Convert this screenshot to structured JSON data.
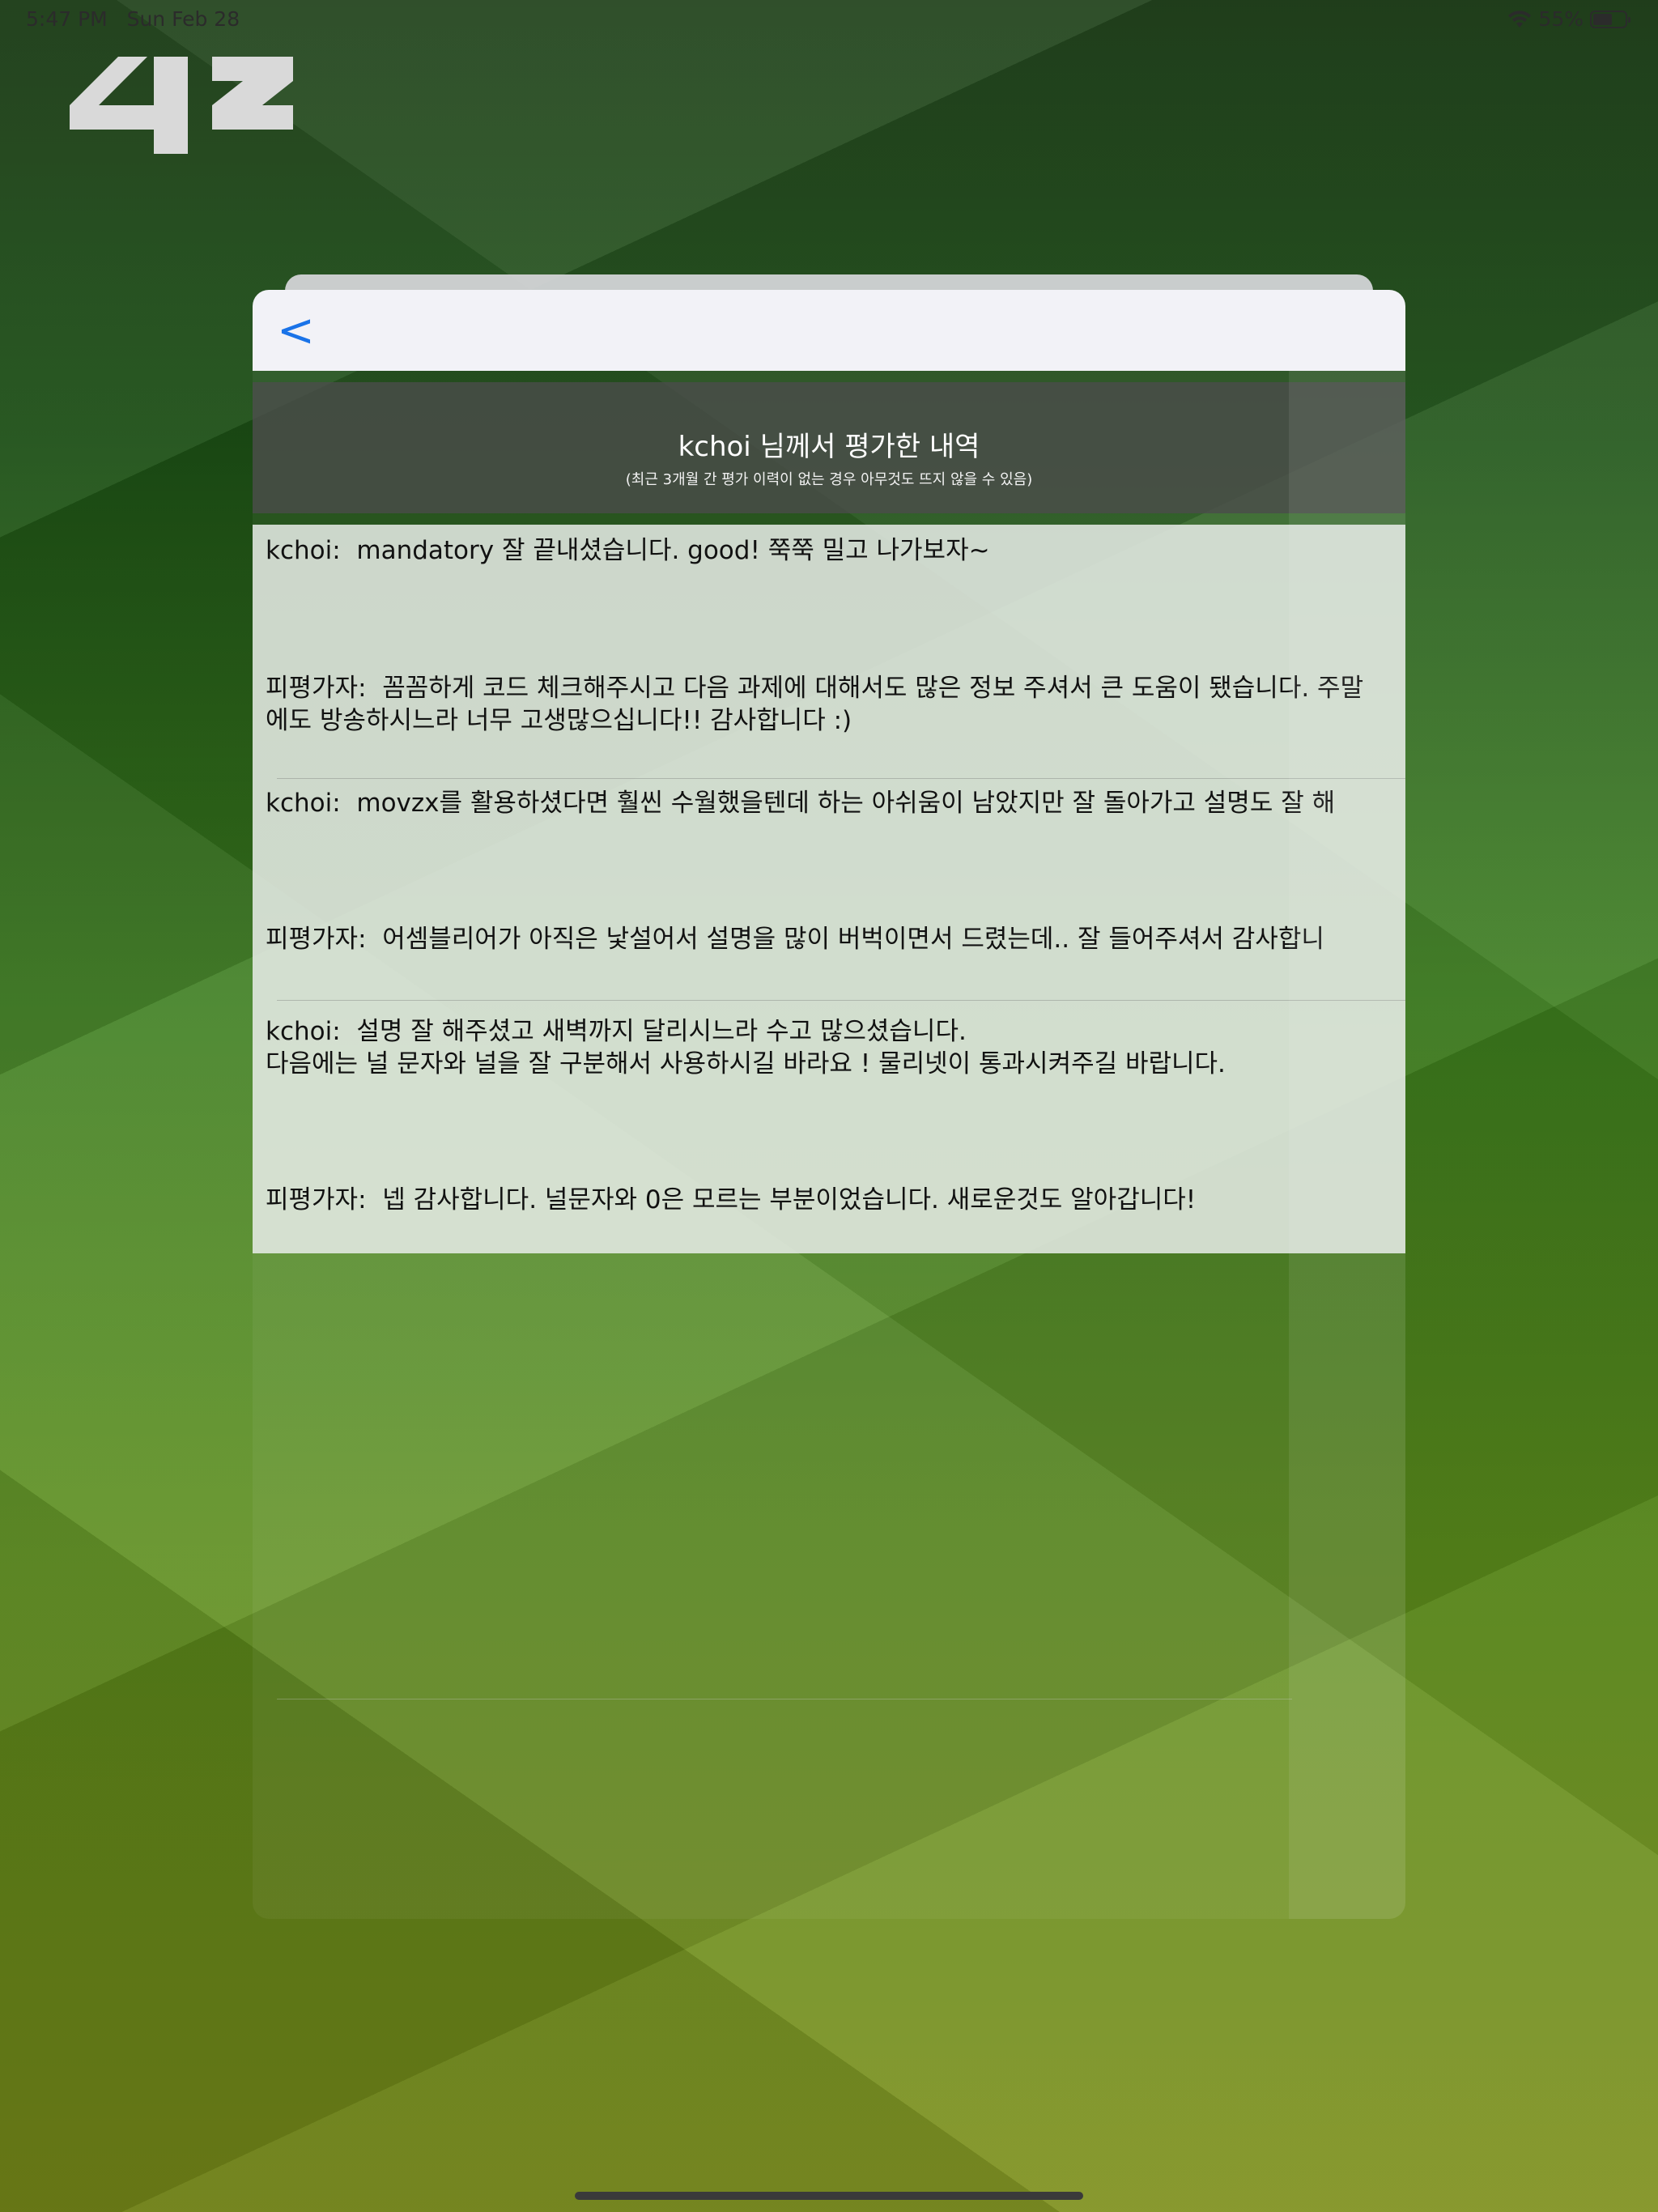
{
  "status_bar": {
    "time": "5:47 PM",
    "date": "Sun Feb 28",
    "battery": "55%"
  },
  "logo": {
    "text": "42"
  },
  "nav": {
    "back_label": "<"
  },
  "header": {
    "title": "kchoi 님께서 평가한 내역",
    "subtitle": "(최근 3개월 간 평가 이력이 없는 경우 아무것도 뜨지 않을 수 있음)"
  },
  "evaluations": [
    {
      "evaluator": "kchoi:  mandatory 잘 끝내셨습니다. good! 쭉쭉 밀고 나가보자~",
      "evaluatee": "피평가자:  꼼꼼하게 코드 체크해주시고 다음 과제에 대해서도 많은 정보 주셔서 큰 도움이 됐습니다. 주말에도 방송하시느라 너무 고생많으십니다!! 감사합니다 :)"
    },
    {
      "evaluator": "kchoi:  movzx를 활용하셨다면 훨씬 수월했을텐데 하는 아쉬움이 남았지만 잘 돌아가고 설명도 잘 해",
      "evaluatee": "피평가자:  어셈블리어가 아직은 낯설어서 설명을 많이 버벅이면서 드렸는데.. 잘 들어주셔서 감사합니"
    },
    {
      "evaluator": "kchoi:  설명 잘 해주셨고 새벽까지 달리시느라 수고 많으셨습니다.\n다음에는 널 문자와 널을 잘 구분해서 사용하시길 바라요 ! 물리넷이 통과시켜주길 바랍니다.",
      "evaluatee": "피평가자:  넵 감사합니다. 널문자와 0은 모르는 부분이었습니다. 새로운것도 알아갑니다!"
    }
  ]
}
